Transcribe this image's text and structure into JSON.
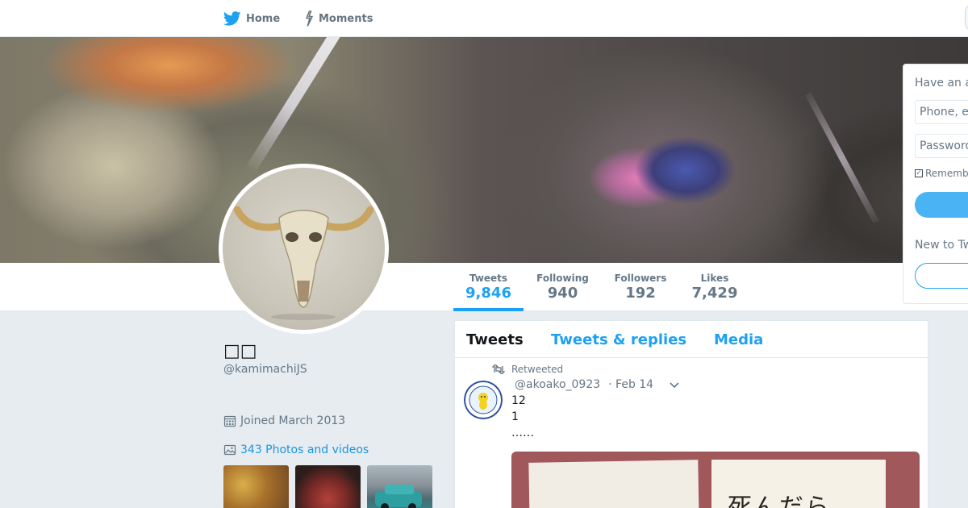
{
  "nav": {
    "home_label": "Home",
    "moments_label": "Moments"
  },
  "stats": [
    {
      "label": "Tweets",
      "value": "9,846",
      "active": true
    },
    {
      "label": "Following",
      "value": "940"
    },
    {
      "label": "Followers",
      "value": "192"
    },
    {
      "label": "Likes",
      "value": "7,429"
    }
  ],
  "profile": {
    "name": "□□",
    "handle": "@kamimachiJS",
    "joined": "Joined March 2013",
    "photos_link": "343 Photos and videos"
  },
  "timeline": {
    "tabs": [
      "Tweets",
      "Tweets & replies",
      "Media"
    ],
    "active_tab": "Tweets",
    "tweet": {
      "retweet_label": "Retweeted",
      "author_handle": "@akoako_0923",
      "date": "· Feb 14",
      "lines": [
        "12",
        "1",
        "……"
      ],
      "media_text": "死んだら"
    }
  },
  "login": {
    "title": "Have an a",
    "phone_placeholder": "Phone, e",
    "password_placeholder": "Password",
    "remember_label": "Rememb",
    "new_to_label": "New to Tw"
  },
  "colors": {
    "accent": "#1da1f2",
    "link": "#1b95e0",
    "muted": "#657786",
    "background": "#e6ecf0"
  },
  "icons": {
    "home": "twitter-bird-icon",
    "moments": "lightning-icon",
    "joined": "calendar-icon",
    "photos": "image-icon",
    "retweet": "retweet-icon",
    "caret": "chevron-down-icon"
  }
}
